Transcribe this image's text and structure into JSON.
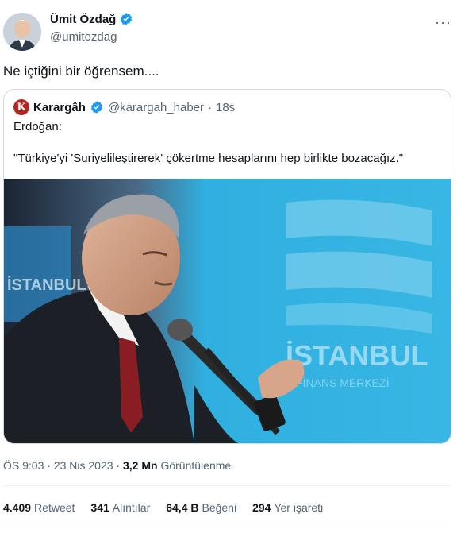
{
  "author": {
    "name": "Ümit Özdağ",
    "handle": "@umitozdag",
    "more_label": "···"
  },
  "tweet": {
    "text": "Ne içtiğini bir öğrensem...."
  },
  "quoted": {
    "avatar_letter": "K",
    "name": "Karargâh",
    "handle": "@karargah_haber",
    "dot": "·",
    "time": "18s",
    "line1": "Erdoğan:",
    "line2": "\"Türkiye'yi 'Suriyelileştirerek' çökertme hesaplarını hep birlikte bozacağız.\"",
    "image_sign_line1": "İSTANBUL",
    "image_sign_line2": "FİNANS MERKEZİ"
  },
  "meta": {
    "time": "ÖS 9:03",
    "sep1": " · ",
    "date": "23 Nis 2023",
    "sep2": " · ",
    "views_value": "3,2 Mn",
    "views_label": "Görüntülenme"
  },
  "stats": {
    "retweets_value": "4.409",
    "retweets_label": "Retweet",
    "quotes_value": "341",
    "quotes_label": "Alıntılar",
    "likes_value": "64,4 B",
    "likes_label": "Beğeni",
    "bookmarks_value": "294",
    "bookmarks_label": "Yer işareti"
  },
  "colors": {
    "verified": "#1d9bf0",
    "secondary_text": "#536471",
    "primary_text": "#0f1419",
    "border": "#cfd9de",
    "image_backdrop": "#2fb0e0"
  }
}
